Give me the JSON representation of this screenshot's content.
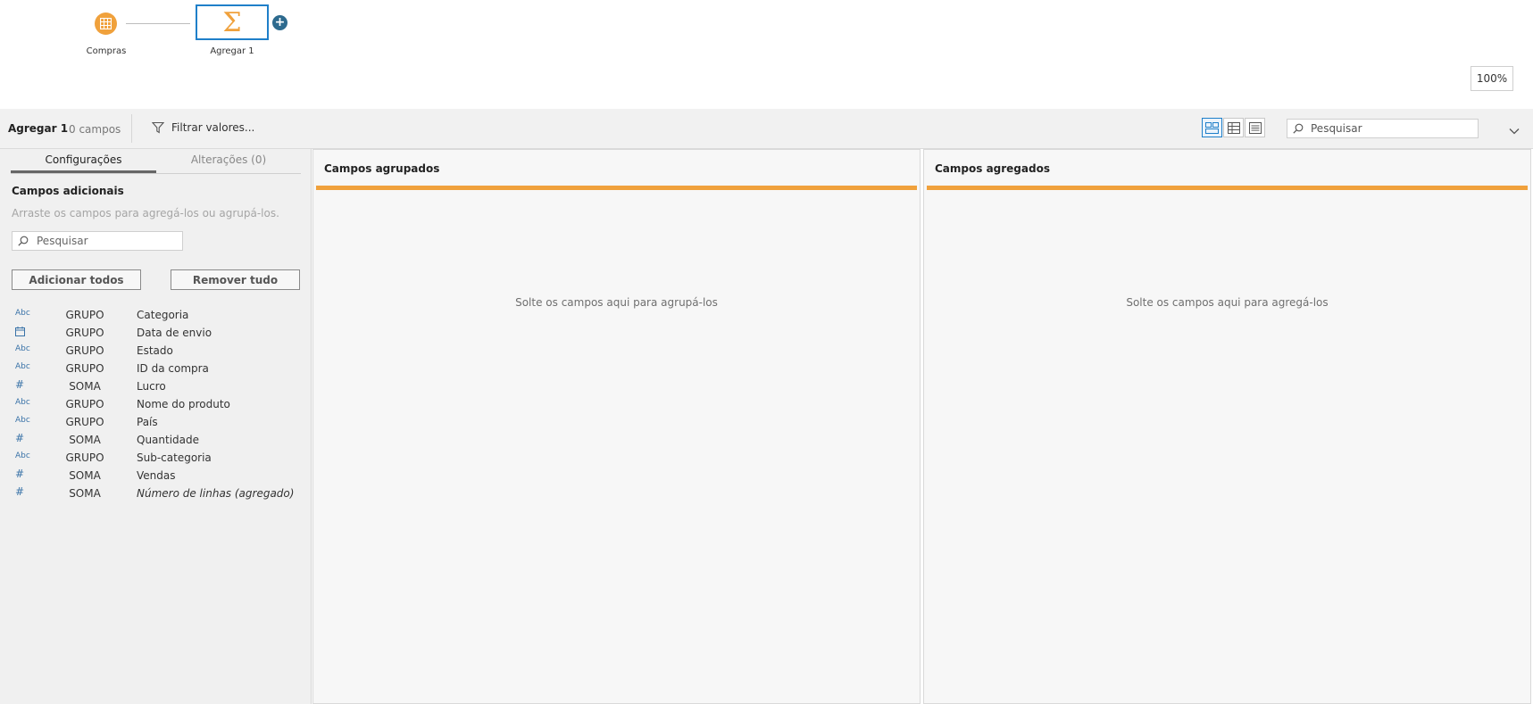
{
  "flow": {
    "input_node": {
      "label": "Compras",
      "icon": "table-icon"
    },
    "aggregate_node": {
      "label": "Agregar 1",
      "symbol": "Σ",
      "icon": "sigma-icon"
    },
    "add_step": "+",
    "zoom": "100%"
  },
  "toolbar": {
    "step_name": "Agregar 1",
    "field_count": "0 campos",
    "filter_label": "Filtrar valores...",
    "search_placeholder": "Pesquisar"
  },
  "sidebar": {
    "tabs": [
      "Configurações",
      "Alterações (0)"
    ],
    "heading": "Campos adicionais",
    "help_text": "Arraste os campos para agregá-los ou agrupá-los.",
    "search_placeholder": "Pesquisar",
    "add_all": "Adicionar todos",
    "remove_all": "Remover tudo",
    "fields": [
      {
        "type": "Abc",
        "role": "GRUPO",
        "name": "Categoria"
      },
      {
        "type": "date",
        "role": "GRUPO",
        "name": "Data de envio"
      },
      {
        "type": "Abc",
        "role": "GRUPO",
        "name": "Estado"
      },
      {
        "type": "Abc",
        "role": "GRUPO",
        "name": "ID da compra"
      },
      {
        "type": "#",
        "role": "SOMA",
        "name": "Lucro"
      },
      {
        "type": "Abc",
        "role": "GRUPO",
        "name": "Nome do produto"
      },
      {
        "type": "Abc",
        "role": "GRUPO",
        "name": "País"
      },
      {
        "type": "#",
        "role": "SOMA",
        "name": "Quantidade"
      },
      {
        "type": "Abc",
        "role": "GRUPO",
        "name": "Sub-categoria"
      },
      {
        "type": "#",
        "role": "SOMA",
        "name": "Vendas"
      },
      {
        "type": "#",
        "role": "SOMA",
        "name": "Número de linhas (agregado)"
      }
    ]
  },
  "grouped_panel": {
    "title": "Campos agrupados",
    "empty": "Solte os campos aqui para agrupá-los"
  },
  "aggregated_panel": {
    "title": "Campos agregados",
    "empty": "Solte os campos aqui para agregá-los"
  },
  "colors": {
    "accent": "#f0a13c",
    "selection": "#1f7fc9",
    "type_icon": "#3a73a8"
  }
}
